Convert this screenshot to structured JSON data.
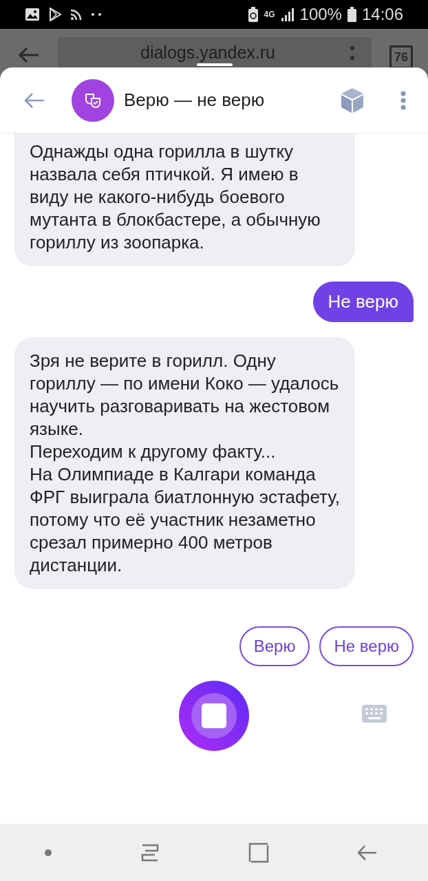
{
  "status_bar": {
    "network": "4G",
    "battery": "100%",
    "time": "14:06"
  },
  "browser": {
    "url": "dialogs.yandex.ru",
    "tab_count": "76"
  },
  "header": {
    "title": "Верю — не верю"
  },
  "messages": [
    {
      "kind": "bot",
      "text": "Однажды одна горилла в шутку назвала себя птичкой. Я имею в виду не какого-нибудь боевого мутанта в блокбастере, а обычную гориллу из зоопарка.",
      "cut": true
    },
    {
      "kind": "user",
      "text": "Не верю"
    },
    {
      "kind": "bot",
      "text": "Зря не верите в горилл. Одну гориллу — по имени Коко — удалось научить разговаривать на жестовом языке.\nПереходим к другому факту...\nНа Олимпиаде в Калгари команда ФРГ выиграла биатлонную эстафету, потому что её участник незаметно срезал примерно 400 метров дистанции."
    }
  ],
  "suggestions": [
    "Верю",
    "Не верю"
  ]
}
